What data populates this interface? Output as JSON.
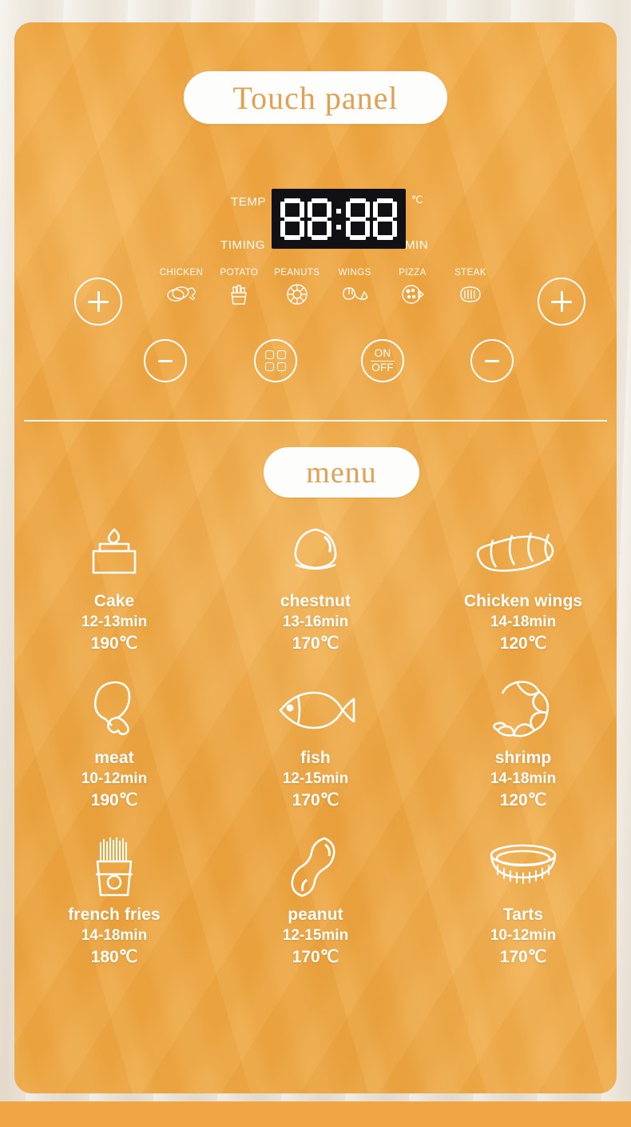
{
  "panel": {
    "title": "Touch panel",
    "display": {
      "temp_label": "TEMP",
      "timing_label": "TIMING",
      "unit_label": "℃",
      "min_label": "MIN",
      "value": "88:88"
    },
    "modes": [
      {
        "label": "CHICKEN",
        "icon": "chicken-icon"
      },
      {
        "label": "POTATO",
        "icon": "fries-icon"
      },
      {
        "label": "PEANUTS",
        "icon": "peanuts-icon"
      },
      {
        "label": "WINGS",
        "icon": "wings-icon"
      },
      {
        "label": "PIZZA",
        "icon": "pizza-icon"
      },
      {
        "label": "STEAK",
        "icon": "steak-icon"
      }
    ],
    "buttons": {
      "plus_left": "+",
      "plus_right": "+",
      "minus_left": "−",
      "minus_right": "−",
      "grid": "menu-grid-icon",
      "power_on": "ON",
      "power_off": "OFF"
    }
  },
  "menu": {
    "title": "menu",
    "items": [
      {
        "name": "Cake",
        "time": "12-13min",
        "temp": "190℃",
        "icon": "cake-icon"
      },
      {
        "name": "chestnut",
        "time": "13-16min",
        "temp": "170℃",
        "icon": "chestnut-icon"
      },
      {
        "name": "Chicken wings",
        "time": "14-18min",
        "temp": "120℃",
        "icon": "chicken-wings-icon"
      },
      {
        "name": "meat",
        "time": "10-12min",
        "temp": "190℃",
        "icon": "drumstick-icon"
      },
      {
        "name": "fish",
        "time": "12-15min",
        "temp": "170℃",
        "icon": "fish-icon"
      },
      {
        "name": "shrimp",
        "time": "14-18min",
        "temp": "120℃",
        "icon": "shrimp-icon"
      },
      {
        "name": "french fries",
        "time": "14-18min",
        "temp": "180℃",
        "icon": "french-fries-icon"
      },
      {
        "name": "peanut",
        "time": "12-15min",
        "temp": "170℃",
        "icon": "peanut-icon"
      },
      {
        "name": "Tarts",
        "time": "10-12min",
        "temp": "170℃",
        "icon": "tart-icon"
      }
    ]
  },
  "colors": {
    "card_orange": "#eda340",
    "accent_text": "#e0a154",
    "white": "#fdfdfb",
    "led_black": "#111014",
    "bottom_bar": "#f2a544"
  }
}
